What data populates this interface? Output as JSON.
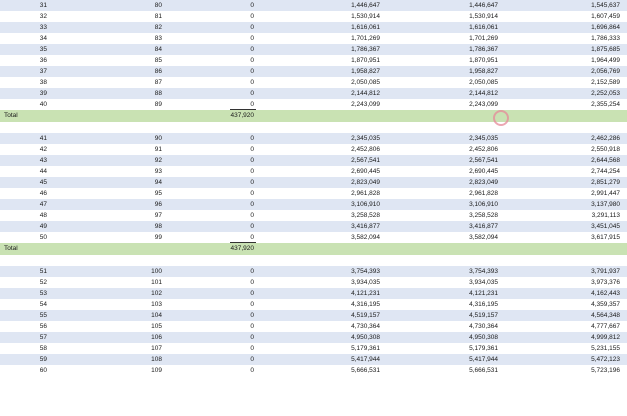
{
  "sheet": {
    "total_label": "Total",
    "rows": [
      {
        "kind": "data",
        "c": [
          "",
          "31",
          "80",
          "0",
          "1,446,647",
          "1,446,647",
          "1,545,637"
        ]
      },
      {
        "kind": "data",
        "c": [
          "",
          "32",
          "81",
          "0",
          "1,530,914",
          "1,530,914",
          "1,607,459"
        ]
      },
      {
        "kind": "data",
        "c": [
          "",
          "33",
          "82",
          "0",
          "1,616,061",
          "1,616,061",
          "1,696,864"
        ]
      },
      {
        "kind": "data",
        "c": [
          "",
          "34",
          "83",
          "0",
          "1,701,269",
          "1,701,269",
          "1,786,333"
        ]
      },
      {
        "kind": "data",
        "c": [
          "",
          "35",
          "84",
          "0",
          "1,786,367",
          "1,786,367",
          "1,875,685"
        ]
      },
      {
        "kind": "data",
        "c": [
          "",
          "36",
          "85",
          "0",
          "1,870,951",
          "1,870,951",
          "1,964,499"
        ]
      },
      {
        "kind": "data",
        "c": [
          "",
          "37",
          "86",
          "0",
          "1,958,827",
          "1,958,827",
          "2,056,769"
        ]
      },
      {
        "kind": "data",
        "c": [
          "",
          "38",
          "87",
          "0",
          "2,050,085",
          "2,050,085",
          "2,152,589"
        ]
      },
      {
        "kind": "data",
        "c": [
          "",
          "39",
          "88",
          "0",
          "2,144,812",
          "2,144,812",
          "2,252,053"
        ]
      },
      {
        "kind": "data",
        "c": [
          "",
          "40",
          "89",
          "0",
          "2,243,099",
          "2,243,099",
          "2,355,254"
        ]
      },
      {
        "kind": "total",
        "c": [
          "Total",
          "",
          "",
          "437,920",
          "",
          "",
          ""
        ]
      },
      {
        "kind": "gap",
        "c": [
          "",
          "",
          "",
          "",
          "",
          "",
          ""
        ]
      },
      {
        "kind": "data",
        "c": [
          "",
          "41",
          "90",
          "0",
          "2,345,035",
          "2,345,035",
          "2,462,286"
        ]
      },
      {
        "kind": "data",
        "c": [
          "",
          "42",
          "91",
          "0",
          "2,452,806",
          "2,452,806",
          "2,550,918"
        ]
      },
      {
        "kind": "data",
        "c": [
          "",
          "43",
          "92",
          "0",
          "2,567,541",
          "2,567,541",
          "2,644,568"
        ]
      },
      {
        "kind": "data",
        "c": [
          "",
          "44",
          "93",
          "0",
          "2,690,445",
          "2,690,445",
          "2,744,254"
        ]
      },
      {
        "kind": "data",
        "c": [
          "",
          "45",
          "94",
          "0",
          "2,823,049",
          "2,823,049",
          "2,851,279"
        ]
      },
      {
        "kind": "data",
        "c": [
          "",
          "46",
          "95",
          "0",
          "2,961,828",
          "2,961,828",
          "2,991,447"
        ]
      },
      {
        "kind": "data",
        "c": [
          "",
          "47",
          "96",
          "0",
          "3,106,910",
          "3,106,910",
          "3,137,980"
        ]
      },
      {
        "kind": "data",
        "c": [
          "",
          "48",
          "97",
          "0",
          "3,258,528",
          "3,258,528",
          "3,291,113"
        ]
      },
      {
        "kind": "data",
        "c": [
          "",
          "49",
          "98",
          "0",
          "3,416,877",
          "3,416,877",
          "3,451,045"
        ]
      },
      {
        "kind": "data",
        "c": [
          "",
          "50",
          "99",
          "0",
          "3,582,094",
          "3,582,094",
          "3,617,915"
        ]
      },
      {
        "kind": "total",
        "c": [
          "Total",
          "",
          "",
          "437,920",
          "",
          "",
          ""
        ]
      },
      {
        "kind": "gap",
        "c": [
          "",
          "",
          "",
          "",
          "",
          "",
          ""
        ]
      },
      {
        "kind": "data",
        "c": [
          "",
          "51",
          "100",
          "0",
          "3,754,393",
          "3,754,393",
          "3,791,937"
        ]
      },
      {
        "kind": "data",
        "c": [
          "",
          "52",
          "101",
          "0",
          "3,934,035",
          "3,934,035",
          "3,973,376"
        ]
      },
      {
        "kind": "data",
        "c": [
          "",
          "53",
          "102",
          "0",
          "4,121,231",
          "4,121,231",
          "4,162,443"
        ]
      },
      {
        "kind": "data",
        "c": [
          "",
          "54",
          "103",
          "0",
          "4,316,195",
          "4,316,195",
          "4,359,357"
        ]
      },
      {
        "kind": "data",
        "c": [
          "",
          "55",
          "104",
          "0",
          "4,519,157",
          "4,519,157",
          "4,564,348"
        ]
      },
      {
        "kind": "data",
        "c": [
          "",
          "56",
          "105",
          "0",
          "4,730,364",
          "4,730,364",
          "4,777,667"
        ]
      },
      {
        "kind": "data",
        "c": [
          "",
          "57",
          "106",
          "0",
          "4,950,308",
          "4,950,308",
          "4,999,812"
        ]
      },
      {
        "kind": "data",
        "c": [
          "",
          "58",
          "107",
          "0",
          "5,179,361",
          "5,179,361",
          "5,231,155"
        ]
      },
      {
        "kind": "data",
        "c": [
          "",
          "59",
          "108",
          "0",
          "5,417,944",
          "5,417,944",
          "5,472,123"
        ]
      },
      {
        "kind": "data",
        "c": [
          "",
          "60",
          "109",
          "0",
          "5,666,531",
          "5,666,531",
          "5,723,196"
        ]
      }
    ]
  }
}
